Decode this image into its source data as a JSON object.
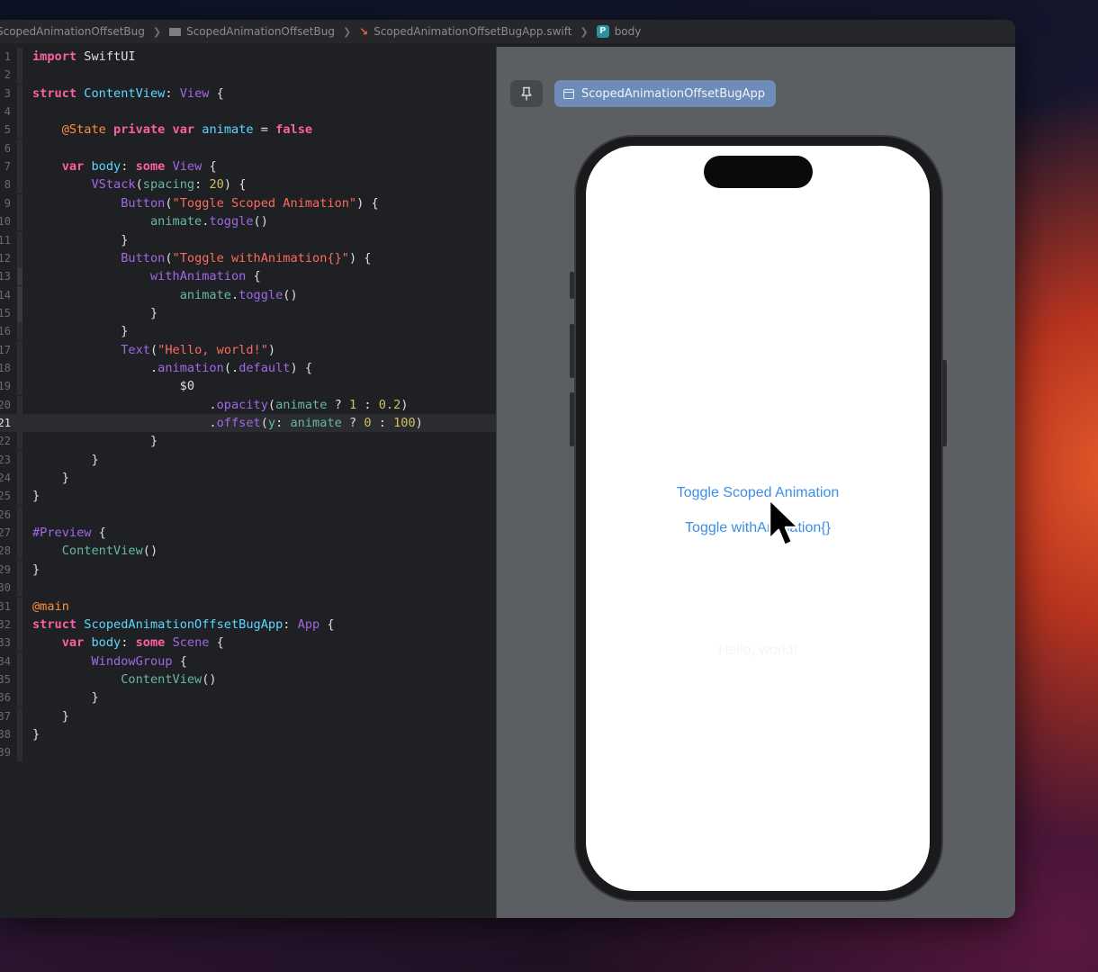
{
  "jumpbar": {
    "crumbs": [
      "ScopedAnimationOffsetBug",
      "ScopedAnimationOffsetBug",
      "ScopedAnimationOffsetBugApp.swift",
      "body"
    ]
  },
  "editor": {
    "current_line": 21,
    "lines": [
      {
        "n": "1",
        "tokens": [
          [
            "kw",
            "import"
          ],
          [
            "pl",
            " SwiftUI"
          ]
        ]
      },
      {
        "n": "2",
        "tokens": []
      },
      {
        "n": "3",
        "tokens": [
          [
            "kw",
            "struct"
          ],
          [
            "pl",
            " "
          ],
          [
            "tp",
            "ContentView"
          ],
          [
            "pl",
            ": "
          ],
          [
            "mt",
            "View"
          ],
          [
            "pl",
            " {"
          ]
        ]
      },
      {
        "n": "4",
        "tokens": []
      },
      {
        "n": "5",
        "tokens": [
          [
            "pl",
            "    "
          ],
          [
            "at",
            "@State"
          ],
          [
            "pl",
            " "
          ],
          [
            "kw",
            "private"
          ],
          [
            "pl",
            " "
          ],
          [
            "kw",
            "var"
          ],
          [
            "pl",
            " "
          ],
          [
            "tp",
            "animate"
          ],
          [
            "pl",
            " = "
          ],
          [
            "kw",
            "false"
          ]
        ]
      },
      {
        "n": "6",
        "tokens": []
      },
      {
        "n": "7",
        "tokens": [
          [
            "pl",
            "    "
          ],
          [
            "kw",
            "var"
          ],
          [
            "pl",
            " "
          ],
          [
            "tp",
            "body"
          ],
          [
            "pl",
            ": "
          ],
          [
            "kw",
            "some"
          ],
          [
            "pl",
            " "
          ],
          [
            "mt",
            "View"
          ],
          [
            "pl",
            " {"
          ]
        ]
      },
      {
        "n": "8",
        "tokens": [
          [
            "pl",
            "        "
          ],
          [
            "mt",
            "VStack"
          ],
          [
            "pl",
            "("
          ],
          [
            "fn",
            "spacing"
          ],
          [
            "pl",
            ": "
          ],
          [
            "nm",
            "20"
          ],
          [
            "pl",
            ") {"
          ]
        ]
      },
      {
        "n": "9",
        "tokens": [
          [
            "pl",
            "            "
          ],
          [
            "mt",
            "Button"
          ],
          [
            "pl",
            "("
          ],
          [
            "st",
            "\"Toggle Scoped Animation\""
          ],
          [
            "pl",
            ") {"
          ]
        ]
      },
      {
        "n": "10",
        "tokens": [
          [
            "pl",
            "                "
          ],
          [
            "fn",
            "animate"
          ],
          [
            "pl",
            "."
          ],
          [
            "mt",
            "toggle"
          ],
          [
            "pl",
            "()"
          ]
        ]
      },
      {
        "n": "11",
        "tokens": [
          [
            "pl",
            "            }"
          ]
        ]
      },
      {
        "n": "12",
        "tokens": [
          [
            "pl",
            "            "
          ],
          [
            "mt",
            "Button"
          ],
          [
            "pl",
            "("
          ],
          [
            "st",
            "\"Toggle withAnimation{}\""
          ],
          [
            "pl",
            ") {"
          ]
        ]
      },
      {
        "n": "13",
        "tokens": [
          [
            "pl",
            "                "
          ],
          [
            "mt",
            "withAnimation"
          ],
          [
            "pl",
            " {"
          ]
        ]
      },
      {
        "n": "14",
        "tokens": [
          [
            "pl",
            "                    "
          ],
          [
            "fn",
            "animate"
          ],
          [
            "pl",
            "."
          ],
          [
            "mt",
            "toggle"
          ],
          [
            "pl",
            "()"
          ]
        ]
      },
      {
        "n": "15",
        "tokens": [
          [
            "pl",
            "                }"
          ]
        ]
      },
      {
        "n": "16",
        "tokens": [
          [
            "pl",
            "            }"
          ]
        ]
      },
      {
        "n": "17",
        "tokens": [
          [
            "pl",
            "            "
          ],
          [
            "mt",
            "Text"
          ],
          [
            "pl",
            "("
          ],
          [
            "st",
            "\"Hello, world!\""
          ],
          [
            "pl",
            ")"
          ]
        ]
      },
      {
        "n": "18",
        "tokens": [
          [
            "pl",
            "                ."
          ],
          [
            "mt",
            "animation"
          ],
          [
            "pl",
            "(."
          ],
          [
            "mt",
            "default"
          ],
          [
            "pl",
            ") {"
          ]
        ]
      },
      {
        "n": "19",
        "tokens": [
          [
            "pl",
            "                    $0"
          ]
        ]
      },
      {
        "n": "20",
        "tokens": [
          [
            "pl",
            "                        ."
          ],
          [
            "mt",
            "opacity"
          ],
          [
            "pl",
            "("
          ],
          [
            "fn",
            "animate"
          ],
          [
            "pl",
            " ? "
          ],
          [
            "nm",
            "1"
          ],
          [
            "pl",
            " : "
          ],
          [
            "nm",
            "0.2"
          ],
          [
            "pl",
            ")"
          ]
        ]
      },
      {
        "n": "21",
        "tokens": [
          [
            "pl",
            "                        ."
          ],
          [
            "mt",
            "offset"
          ],
          [
            "pl",
            "("
          ],
          [
            "fn",
            "y"
          ],
          [
            "pl",
            ": "
          ],
          [
            "fn",
            "animate"
          ],
          [
            "pl",
            " ? "
          ],
          [
            "nm",
            "0"
          ],
          [
            "pl",
            " : "
          ],
          [
            "nm",
            "100"
          ],
          [
            "pl",
            ")"
          ]
        ]
      },
      {
        "n": "22",
        "tokens": [
          [
            "pl",
            "                }"
          ]
        ]
      },
      {
        "n": "23",
        "tokens": [
          [
            "pl",
            "        }"
          ]
        ]
      },
      {
        "n": "24",
        "tokens": [
          [
            "pl",
            "    }"
          ]
        ]
      },
      {
        "n": "25",
        "tokens": [
          [
            "pl",
            "}"
          ]
        ]
      },
      {
        "n": "26",
        "tokens": []
      },
      {
        "n": "27",
        "tokens": [
          [
            "mt",
            "#Preview"
          ],
          [
            "pl",
            " {"
          ]
        ]
      },
      {
        "n": "28",
        "tokens": [
          [
            "pl",
            "    "
          ],
          [
            "fn",
            "ContentView"
          ],
          [
            "pl",
            "()"
          ]
        ]
      },
      {
        "n": "29",
        "tokens": [
          [
            "pl",
            "}"
          ]
        ]
      },
      {
        "n": "30",
        "tokens": []
      },
      {
        "n": "31",
        "tokens": [
          [
            "at",
            "@main"
          ]
        ]
      },
      {
        "n": "32",
        "tokens": [
          [
            "kw",
            "struct"
          ],
          [
            "pl",
            " "
          ],
          [
            "tp",
            "ScopedAnimationOffsetBugApp"
          ],
          [
            "pl",
            ": "
          ],
          [
            "mt",
            "App"
          ],
          [
            "pl",
            " {"
          ]
        ]
      },
      {
        "n": "33",
        "tokens": [
          [
            "pl",
            "    "
          ],
          [
            "kw",
            "var"
          ],
          [
            "pl",
            " "
          ],
          [
            "tp",
            "body"
          ],
          [
            "pl",
            ": "
          ],
          [
            "kw",
            "some"
          ],
          [
            "pl",
            " "
          ],
          [
            "mt",
            "Scene"
          ],
          [
            "pl",
            " {"
          ]
        ]
      },
      {
        "n": "34",
        "tokens": [
          [
            "pl",
            "        "
          ],
          [
            "mt",
            "WindowGroup"
          ],
          [
            "pl",
            " {"
          ]
        ]
      },
      {
        "n": "35",
        "tokens": [
          [
            "pl",
            "            "
          ],
          [
            "fn",
            "ContentView"
          ],
          [
            "pl",
            "()"
          ]
        ]
      },
      {
        "n": "36",
        "tokens": [
          [
            "pl",
            "        }"
          ]
        ]
      },
      {
        "n": "37",
        "tokens": [
          [
            "pl",
            "    }"
          ]
        ]
      },
      {
        "n": "38",
        "tokens": [
          [
            "pl",
            "}"
          ]
        ]
      },
      {
        "n": "39",
        "tokens": []
      }
    ]
  },
  "canvas": {
    "pin_icon": "pin-icon",
    "scheme_label": "ScopedAnimationOffsetBugApp"
  },
  "preview": {
    "button_scoped": "Toggle Scoped Animation",
    "button_with_animation": "Toggle withAnimation{}",
    "hello_text": "Hello, world!",
    "hello_opacity": 0.2
  },
  "colors": {
    "link_blue": "#3c8ee6",
    "keyword": "#fc5fa3",
    "string": "#fc6a5d",
    "type": "#5dd8ff",
    "number": "#d0bf69"
  }
}
